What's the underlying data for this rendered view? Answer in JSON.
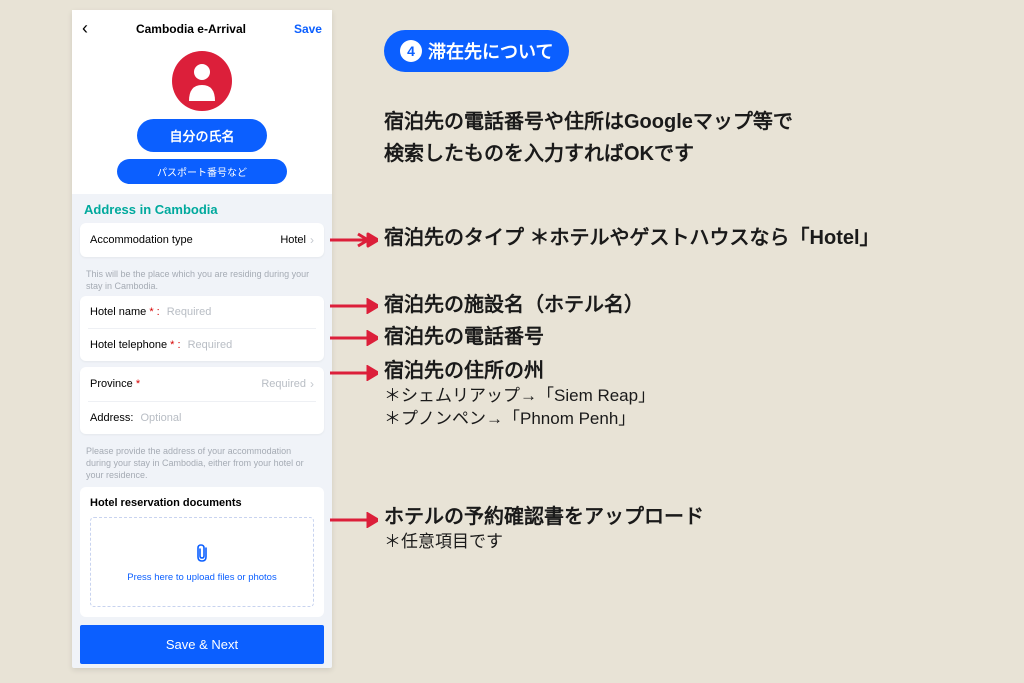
{
  "phone": {
    "title": "Cambodia e-Arrival",
    "save": "Save",
    "name_pill": "自分の氏名",
    "passport_pill": "パスポート番号など",
    "section_title": "Address in Cambodia",
    "accommodation_type_label": "Accommodation type",
    "accommodation_type_value": "Hotel",
    "accommodation_helper": "This will be the place which you are residing during your stay in Cambodia.",
    "hotel_name_label": "Hotel name",
    "hotel_tel_label": "Hotel telephone",
    "province_label": "Province",
    "address_label": "Address:",
    "required": "Required",
    "optional": "Optional",
    "address_helper": "Please provide the address of your accommodation during your stay in Cambodia, either from your hotel or your residence.",
    "upload_title": "Hotel reservation documents",
    "upload_text": "Press here to upload files or photos",
    "save_next": "Save & Next",
    "colon_star": " * :",
    "star_only": " *"
  },
  "callout": {
    "num": "4",
    "title": "滞在先について"
  },
  "intro": {
    "line1": "宿泊先の電話番号や住所はGoogleマップ等で",
    "line2": "検索したものを入力すればOKです"
  },
  "anno": {
    "type": "宿泊先のタイプ ＊ホテルやゲストハウスなら「Hotel」",
    "name": "宿泊先の施設名（ホテル名）",
    "tel": "宿泊先の電話番号",
    "province": "宿泊先の住所の州",
    "province_sub1": "＊シェムリアップ→「Siem Reap」",
    "province_sub2": "＊プノンペン→「Phnom Penh」",
    "upload": "ホテルの予約確認書をアップロード",
    "upload_sub": "＊任意項目です"
  }
}
